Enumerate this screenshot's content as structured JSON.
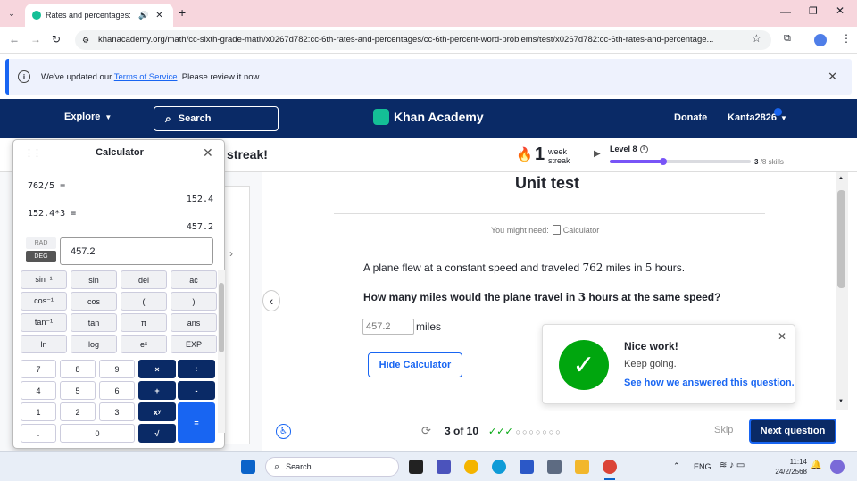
{
  "browser": {
    "tab_title": "Rates and percentages: Uni",
    "url": "khanacademy.org/math/cc-sixth-grade-math/x0267d782:cc-6th-rates-and-percentages/cc-6th-percent-word-problems/test/x0267d782:cc-6th-rates-and-percentage..."
  },
  "notice": {
    "text_before": "We've updated our ",
    "link": "Terms of Service",
    "text_after": ". Please review it now."
  },
  "header": {
    "explore": "Explore",
    "search": "Search",
    "logo": "Khan Academy",
    "donate": "Donate",
    "user": "Kanta2826"
  },
  "streak": {
    "partial_title": "streak!",
    "count": "1",
    "unit_top": "week",
    "unit_bottom": "streak",
    "level": "Level 8",
    "skills_count": "3",
    "skills_total": "/8 skills",
    "progress": 0.38
  },
  "calculator": {
    "title": "Calculator",
    "history": [
      {
        "expr": "762/5 =",
        "result": "152.4"
      },
      {
        "expr": "152.4*3 =",
        "result": "457.2"
      }
    ],
    "mode_rad": "RAD",
    "mode_deg": "DEG",
    "display": "457.2",
    "sci_rows": [
      [
        "sin⁻¹",
        "sin",
        "del",
        "ac"
      ],
      [
        "cos⁻¹",
        "cos",
        "(",
        ")"
      ],
      [
        "tan⁻¹",
        "tan",
        "π",
        "ans"
      ],
      [
        "ln",
        "log",
        "eˣ",
        "EXP"
      ]
    ],
    "num_rows": [
      [
        "7",
        "8",
        "9",
        "×",
        "÷"
      ],
      [
        "4",
        "5",
        "6",
        "+",
        "-"
      ],
      [
        "1",
        "2",
        "3",
        "xʸ"
      ],
      [
        ".",
        "0",
        "√"
      ]
    ],
    "equals": "="
  },
  "main": {
    "title": "Unit test",
    "might_need_label": "You might need:",
    "might_need_tool": "Calculator",
    "problem_prefix": "A plane flew at a constant speed and traveled ",
    "problem_miles": "762",
    "problem_mid": " miles in ",
    "problem_hours": "5",
    "problem_suffix": " hours.",
    "question_prefix": "How many miles would the plane travel in ",
    "question_hours": "3",
    "question_suffix": " hours at the same speed?",
    "answer": "457.2",
    "answer_unit": "miles",
    "hide_calc": "Hide Calculator"
  },
  "toast": {
    "title": "Nice work!",
    "subtitle": "Keep going.",
    "link": "See how we answered this question."
  },
  "footer": {
    "progress": "3 of 10",
    "skip": "Skip",
    "next": "Next question"
  },
  "taskbar": {
    "search": "Search",
    "lang": "ENG",
    "time": "11:14",
    "date": "24/2/2568"
  },
  "colors": {
    "ka_navy": "#0a2a66",
    "ka_blue": "#1865f2",
    "success_green": "#00a60e",
    "level_purple": "#7854f7"
  }
}
